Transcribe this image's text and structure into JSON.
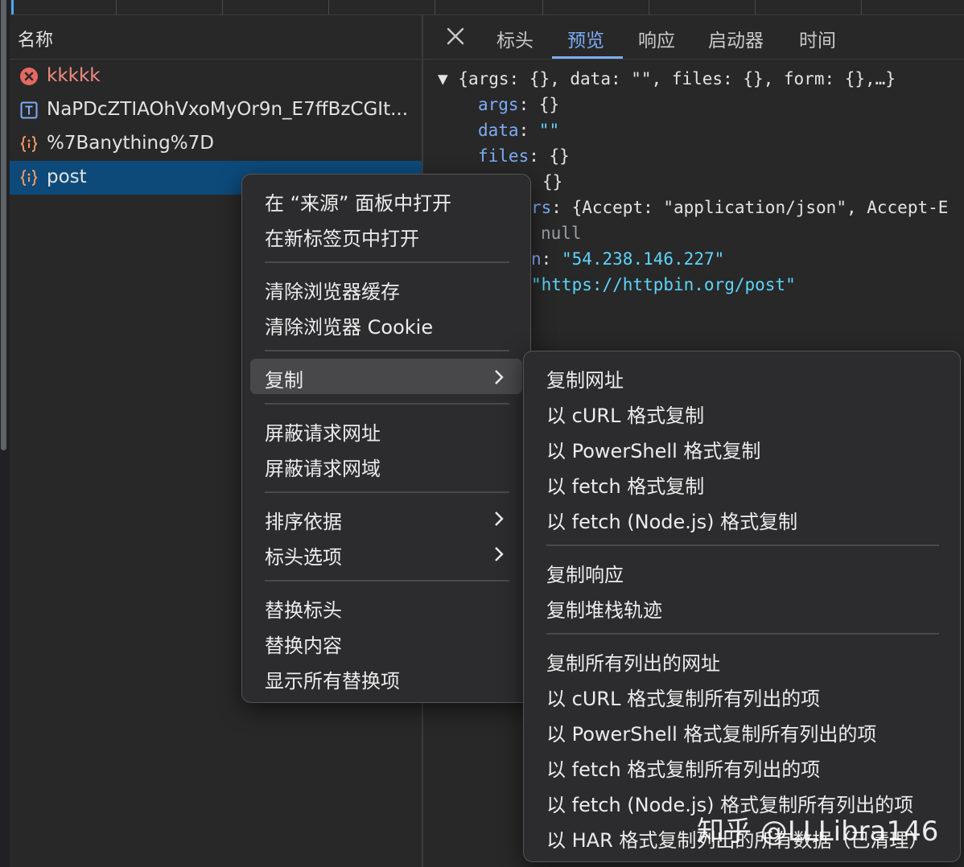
{
  "name_panel": {
    "header": "名称",
    "rows": [
      {
        "label": "kkkkk",
        "icon": "error-icon"
      },
      {
        "label": "NaPDcZTIAOhVxoMyOr9n_E7ffBzCGIt...",
        "icon": "text-doc-icon"
      },
      {
        "label": "%7Banything%7D",
        "icon": "json-icon"
      },
      {
        "label": "post",
        "icon": "json-icon"
      }
    ]
  },
  "tabs": {
    "close": "close-icon",
    "items": [
      "标头",
      "预览",
      "响应",
      "启动器",
      "时间"
    ],
    "active": "预览"
  },
  "preview": {
    "summary": "{args: {}, data: \"\", files: {}, form: {},…}",
    "args_key": "args",
    "args_val": "{}",
    "data_key": "data",
    "data_val": "\"\"",
    "files_key": "files",
    "files_val": "{}",
    "form_val": "{}",
    "headers_key": "rs",
    "headers_val": "{Accept: \"application/json\", Accept-E",
    "json_val": "null",
    "origin_key": "n",
    "origin_val": "\"54.238.146.227\"",
    "url_val": "\"https://httpbin.org/post\""
  },
  "context_menu": {
    "items": [
      "在 “来源” 面板中打开",
      "在新标签页中打开",
      "清除浏览器缓存",
      "清除浏览器 Cookie",
      "复制",
      "屏蔽请求网址",
      "屏蔽请求网域",
      "排序依据",
      "标头选项",
      "替换标头",
      "替换内容",
      "显示所有替换项"
    ]
  },
  "copy_submenu": {
    "items": [
      "复制网址",
      "以 cURL 格式复制",
      "以 PowerShell 格式复制",
      "以 fetch 格式复制",
      "以 fetch (Node.js) 格式复制",
      "复制响应",
      "复制堆栈轨迹",
      "复制所有列出的网址",
      "以 cURL 格式复制所有列出的项",
      "以 PowerShell 格式复制所有列出的项",
      "以 fetch 格式复制所有列出的项",
      "以 fetch (Node.js) 格式复制所有列出的项",
      "以 HAR 格式复制列出的所有数据（已清理）"
    ]
  },
  "watermark": "知乎 @LLLibra146",
  "colors": {
    "accent": "#7cacf8",
    "selected_row": "#0d4a7a",
    "error": "#e46962",
    "json_icon": "#f29766"
  }
}
